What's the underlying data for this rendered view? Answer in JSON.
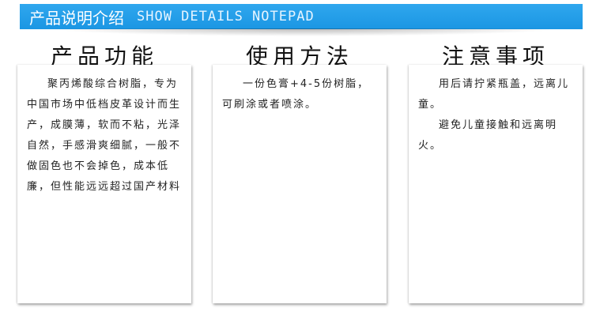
{
  "header": {
    "title": "产品说明介绍",
    "subtitle": "SHOW DETAILS NOTEPAD"
  },
  "cards": [
    {
      "title": "产品功能",
      "paragraphs": [
        "聚丙烯酸综合树脂，专为中国市场中低档皮革设计而生产，成膜薄，软而不粘，光泽自然，手感滑爽细腻，一般不做固色也不会掉色，成本低廉，但性能远远超过国产材料"
      ]
    },
    {
      "title": "使用方法",
      "paragraphs": [
        "一份色膏+4-5份树脂，可刷涂或者喷涂。"
      ]
    },
    {
      "title": "注意事项",
      "paragraphs": [
        "用后请拧紧瓶盖，远离儿童。",
        "避免儿童接触和远离明火。"
      ]
    }
  ],
  "colors": {
    "header_bg": "#1b96e3",
    "header_text": "#ffffff"
  }
}
